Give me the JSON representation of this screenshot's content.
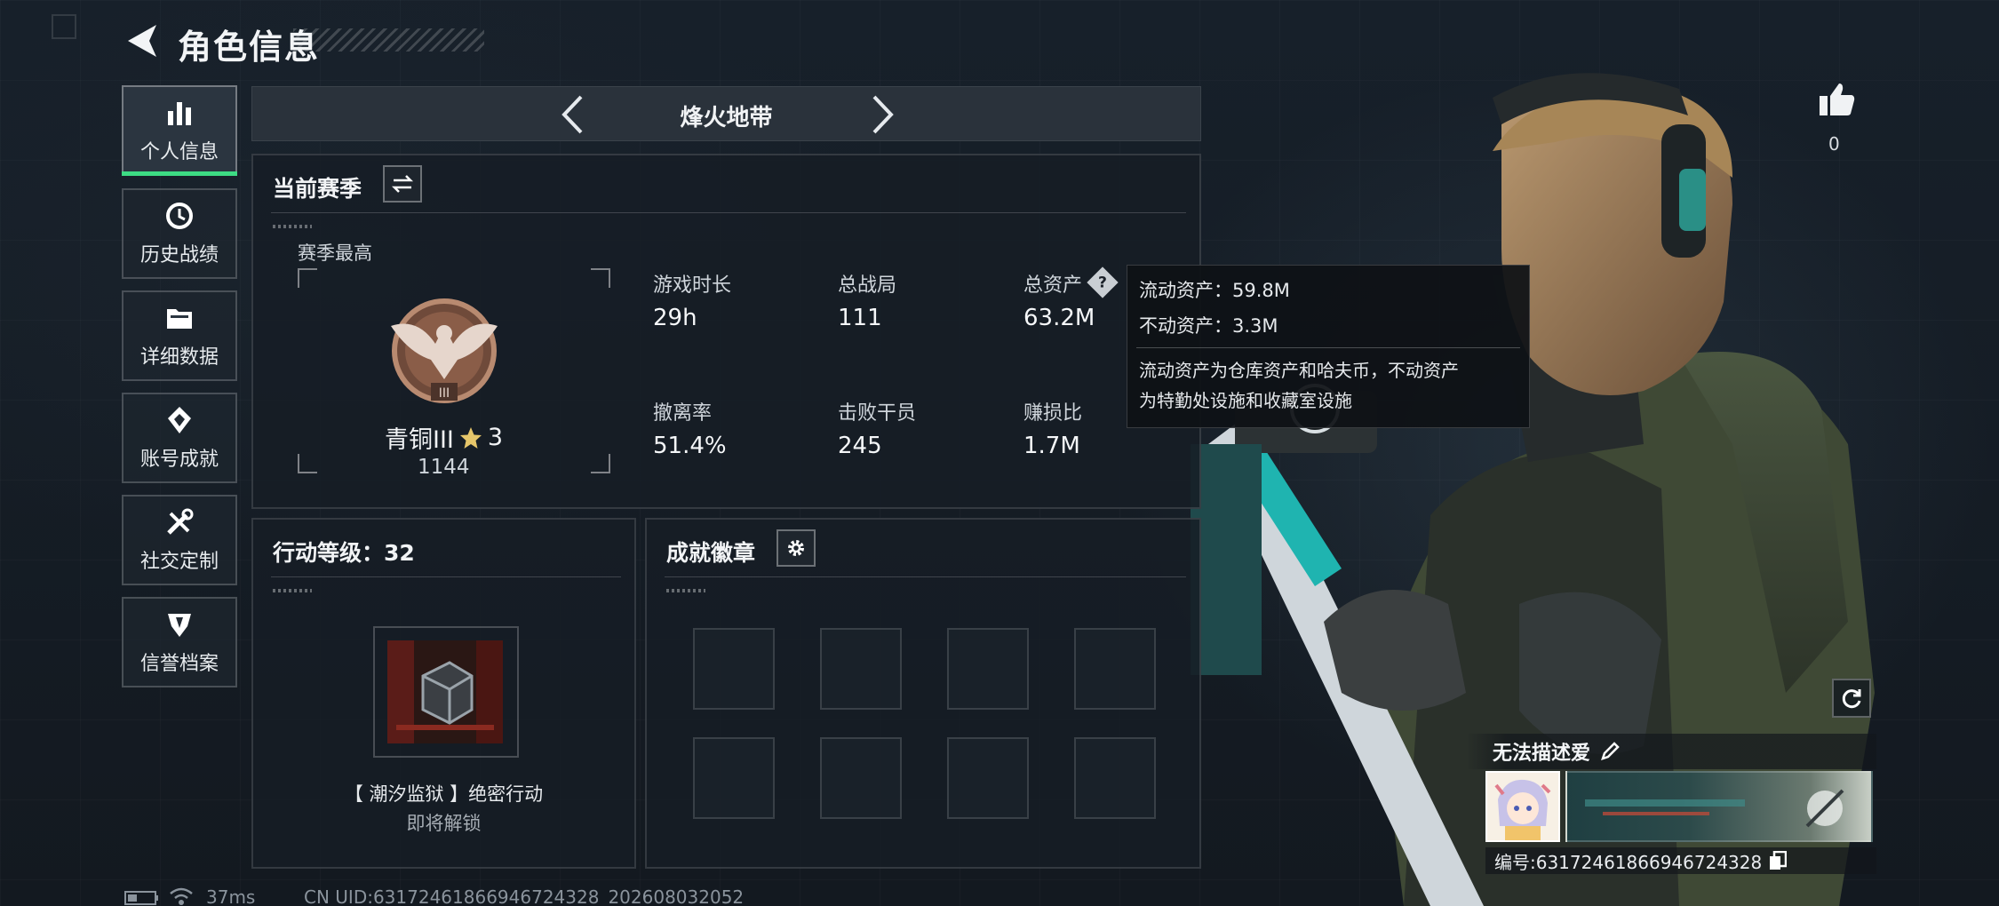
{
  "header": {
    "title": "角色信息"
  },
  "sidebar": {
    "items": [
      {
        "label": "个人信息",
        "icon": "bar-chart-icon",
        "active": true
      },
      {
        "label": "历史战绩",
        "icon": "history-clock-icon"
      },
      {
        "label": "详细数据",
        "icon": "folder-icon"
      },
      {
        "label": "账号成就",
        "icon": "achievement-icon"
      },
      {
        "label": "社交定制",
        "icon": "tools-icon"
      },
      {
        "label": "信誉档案",
        "icon": "shield-badge-icon"
      }
    ]
  },
  "mode_selector": {
    "title": "烽火地带"
  },
  "season": {
    "heading": "当前赛季",
    "best_label": "赛季最高",
    "rank_name": "青铜III",
    "rank_stars": "3",
    "rank_score": "1144",
    "rank_numeral": "III",
    "stats": [
      {
        "label": "游戏时长",
        "value": "29h"
      },
      {
        "label": "总战局",
        "value": "111"
      },
      {
        "label": "总资产",
        "value": "63.2M"
      },
      {
        "label": "撤离率",
        "value": "51.4%"
      },
      {
        "label": "击败干员",
        "value": "245"
      },
      {
        "label": "赚损比",
        "value": "1.7M"
      }
    ]
  },
  "tooltip": {
    "liquid": "流动资产：59.8M",
    "fixed": "不动资产：3.3M",
    "desc_line1": "流动资产为仓库资产和哈夫币，不动资产",
    "desc_line2": "为特勤处设施和收藏室设施"
  },
  "action_level": {
    "heading": "行动等级：32",
    "operation_name": "【 潮汐监狱 】绝密行动",
    "operation_status": "即将解锁"
  },
  "achievements": {
    "heading": "成就徽章"
  },
  "profile": {
    "likes": "0",
    "name": "无法描述爱",
    "id_text": "编号:63172461866946724328"
  },
  "status_bar": {
    "ping": "37ms",
    "uid": "CN UID:63172461866946724328_202608032052"
  },
  "colors": {
    "accent_green": "#3ddc84",
    "panel": "#1b222b",
    "bronze": "#9a6a52"
  }
}
